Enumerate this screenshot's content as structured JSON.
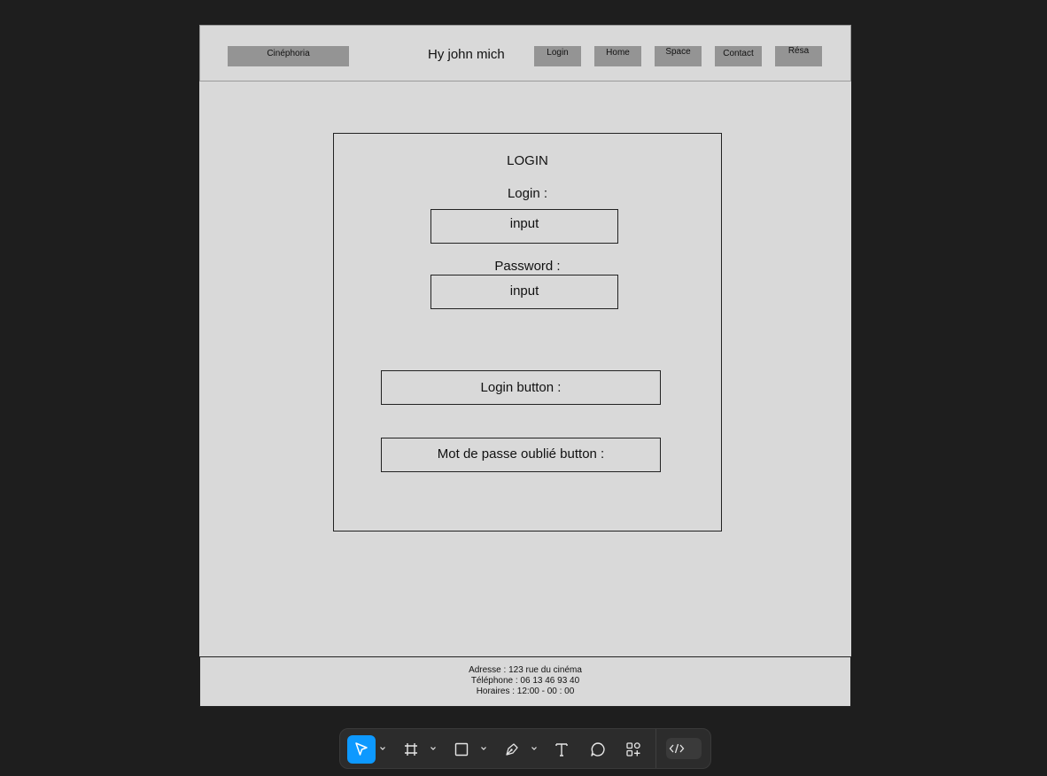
{
  "header": {
    "brand": "Cinéphoria",
    "greeting": "Hy john mich",
    "nav": [
      "Login",
      "Home",
      "Space",
      "Contact",
      "Résa"
    ]
  },
  "login_form": {
    "title": "LOGIN",
    "login_label": "Login :",
    "login_input": "input",
    "password_label": "Password :",
    "password_input": "input",
    "login_button": "Login button :",
    "forgot_button": "Mot de passe oublié button :"
  },
  "footer": {
    "address": "Adresse : 123 rue du cinéma",
    "phone": "Téléphone : 06 13 46 93 40",
    "hours": "Horaires : 12:00 - 00 : 00"
  },
  "toolbar": {
    "tools": [
      "move-tool",
      "frame-tool",
      "shape-tool",
      "pen-tool",
      "text-tool",
      "comment-tool",
      "actions-tool"
    ],
    "dev_mode": "dev-mode-toggle",
    "colors": {
      "bg": "#2c2c2c",
      "active": "#0d99ff",
      "icon": "#e6e6e6"
    }
  }
}
